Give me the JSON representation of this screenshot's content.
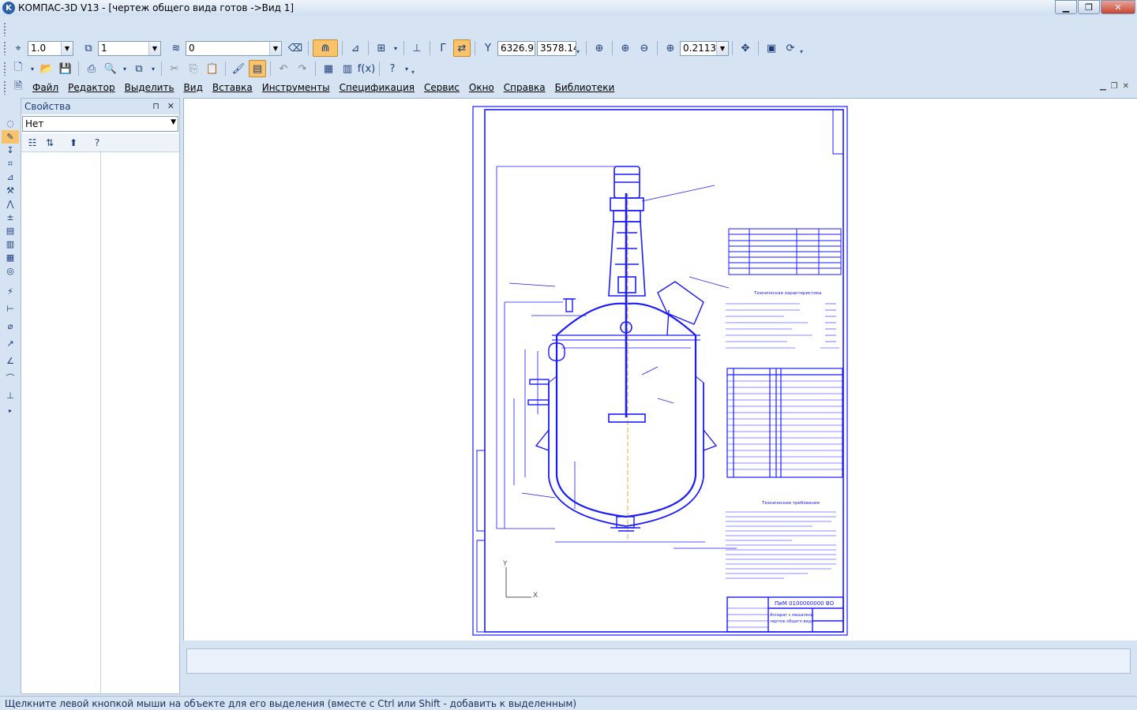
{
  "window": {
    "app_title": "КОМПАС-3D V13 - [чертеж общего вида готов ->Вид 1]",
    "logo_letter": "K",
    "minimize_symbol": "▁",
    "restore_symbol": "❐",
    "close_symbol": "✕"
  },
  "toolbar_view": {
    "step_value": "1.0",
    "layer_value": "1",
    "style_value": "0",
    "coord_x": "6326.9",
    "coord_y": "3578.14",
    "zoom_value": "0.2113"
  },
  "menu": {
    "items": [
      "Файл",
      "Редактор",
      "Выделить",
      "Вид",
      "Вставка",
      "Инструменты",
      "Спецификация",
      "Сервис",
      "Окно",
      "Справка",
      "Библиотеки"
    ]
  },
  "properties_panel": {
    "title": "Свойства",
    "object_value": "Нет"
  },
  "drawing": {
    "doc_code": "ПиМ 0100000000 ВО",
    "doc_title_line1": "Аппарат с мешалкой",
    "doc_title_line2": "чертеж общего вида",
    "tech_char_title": "Техническая характеристика",
    "tech_req_title": "Технические требования",
    "axis_x": "X",
    "axis_y": "Y"
  },
  "status": {
    "hint": "Щелкните левой кнопкой мыши на объекте для его выделения (вместе с Ctrl или Shift - добавить к выделенным)"
  },
  "colors": {
    "drawing_blue": "#1a1aff",
    "accent_orange": "#f8c36a",
    "chrome": "#d6e3f3"
  }
}
